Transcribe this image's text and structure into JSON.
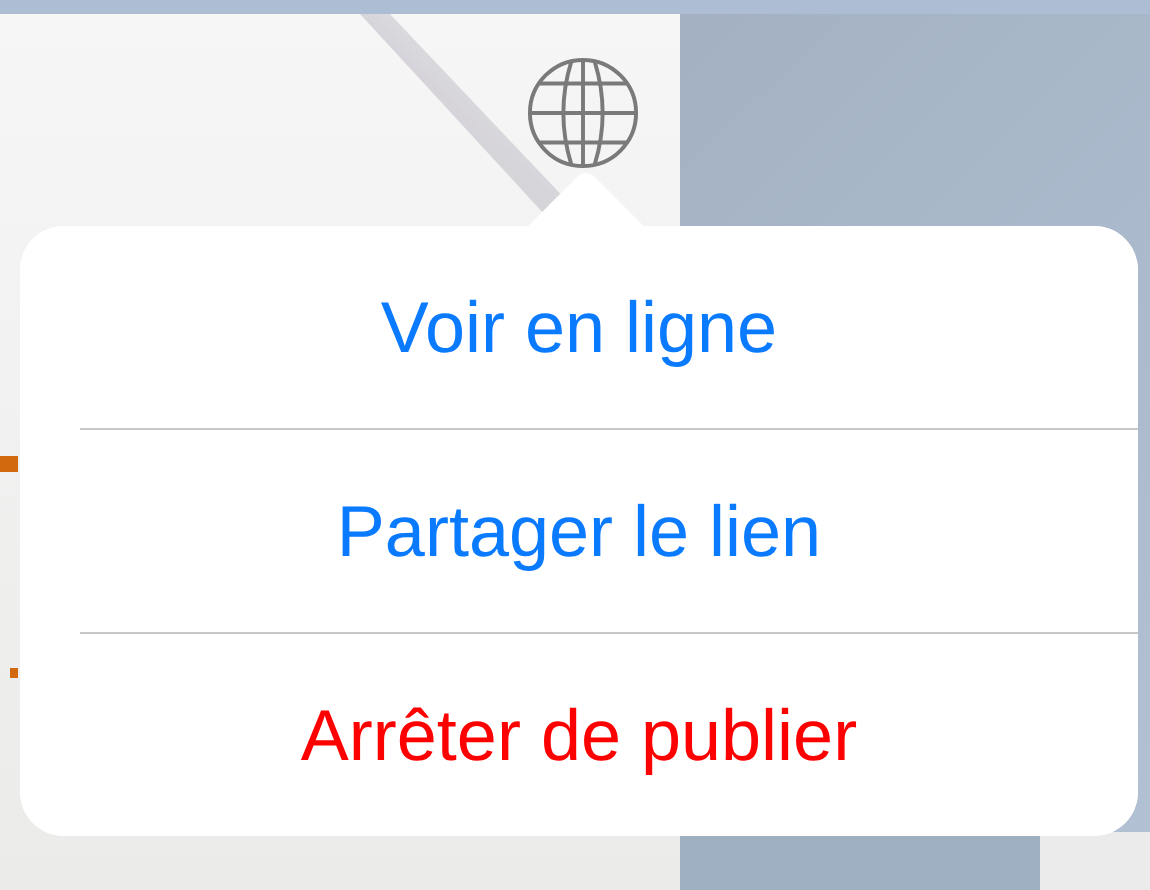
{
  "popover": {
    "items": [
      {
        "label": "Voir en ligne",
        "kind": "action"
      },
      {
        "label": "Partager le lien",
        "kind": "action"
      },
      {
        "label": "Arrêter de publier",
        "kind": "destructive"
      }
    ]
  }
}
